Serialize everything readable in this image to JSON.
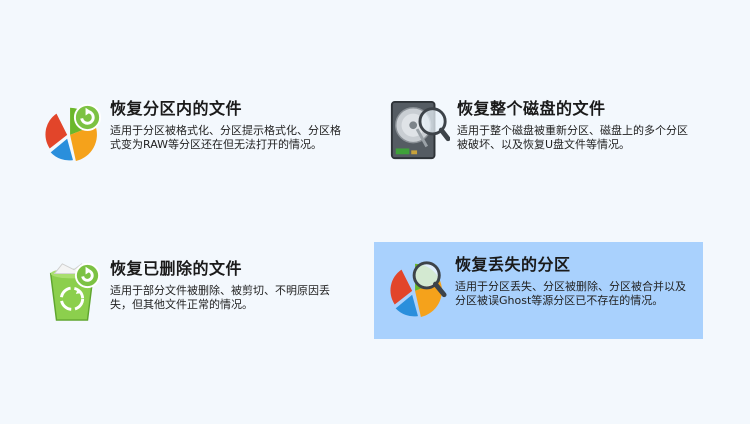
{
  "options": [
    {
      "title": "恢复分区内的文件",
      "description": "适用于分区被格式化、分区提示格式化、分区格式变为RAW等分区还在但无法打开的情况。",
      "icon": "pie-chart-refresh-icon",
      "selected": false
    },
    {
      "title": "恢复整个磁盘的文件",
      "description": "适用于整个磁盘被重新分区、磁盘上的多个分区被破坏、以及恢复U盘文件等情况。",
      "icon": "hard-disk-magnifier-icon",
      "selected": false
    },
    {
      "title": "恢复已删除的文件",
      "description": "适用于部分文件被删除、被剪切、不明原因丢失，但其他文件正常的情况。",
      "icon": "recycle-bin-icon",
      "selected": false
    },
    {
      "title": "恢复丢失的分区",
      "description": "适用于分区丢失、分区被删除、分区被合并以及分区被误Ghost等源分区已不存在的情况。",
      "icon": "pie-chart-magnifier-icon",
      "selected": true
    }
  ],
  "colors": {
    "background": "#f3f8fd",
    "selected_background": "#a9d1fd"
  }
}
